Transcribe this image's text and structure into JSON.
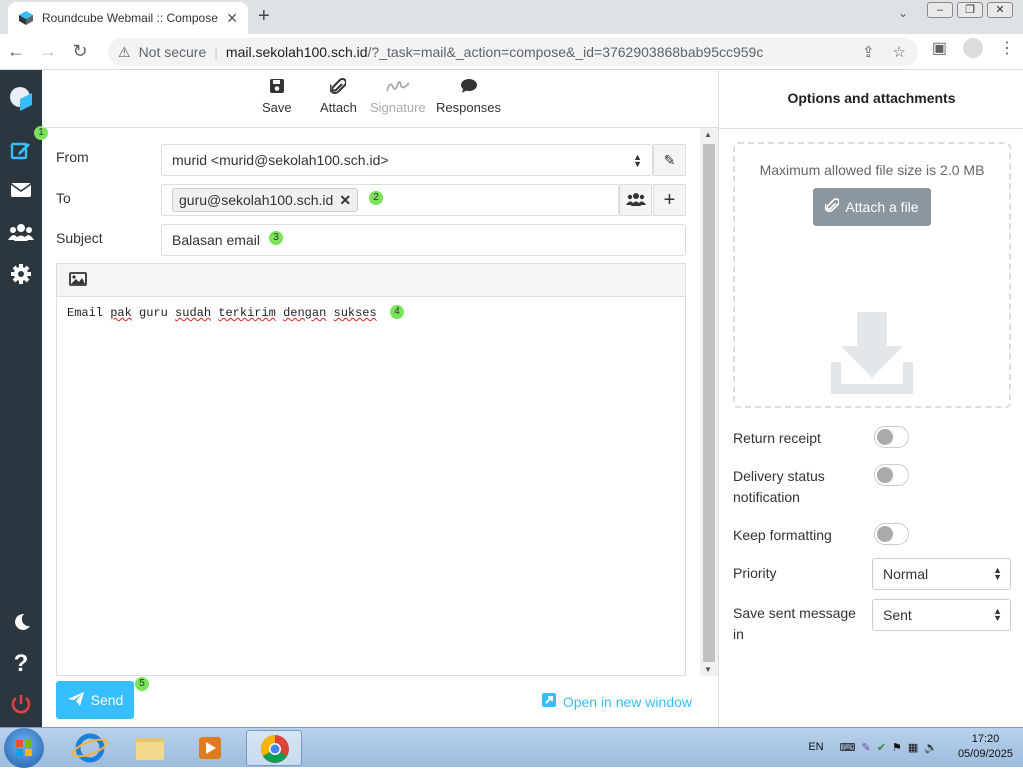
{
  "browser": {
    "tab_title": "Roundcube Webmail :: Compose",
    "not_secure": "Not secure",
    "host": "mail.sekolah100.sch.id",
    "path": "/?_task=mail&_action=compose&_id=3762903868bab95cc959c"
  },
  "toolbar": {
    "save": "Save",
    "attach": "Attach",
    "signature": "Signature",
    "responses": "Responses"
  },
  "compose": {
    "from_label": "From",
    "from_value": "murid <murid@sekolah100.sch.id>",
    "to_label": "To",
    "to_recipient": "guru@sekolah100.sch.id",
    "subject_label": "Subject",
    "subject_value": "Balasan email",
    "body": [
      "Email",
      "pak",
      "guru",
      "sudah",
      "terkirim",
      "dengan",
      "sukses"
    ],
    "send_label": "Send",
    "open_new_window": "Open in new window"
  },
  "badges": [
    "1",
    "2",
    "3",
    "4",
    "5"
  ],
  "options": {
    "title": "Options and attachments",
    "max_size": "Maximum allowed file size is 2.0 MB",
    "attach_file": "Attach a file",
    "return_receipt": "Return receipt",
    "delivery_status": "Delivery status notification",
    "keep_formatting": "Keep formatting",
    "priority_label": "Priority",
    "priority_value": "Normal",
    "save_sent_label": "Save sent message in",
    "save_sent_value": "Sent"
  },
  "taskbar": {
    "lang": "EN",
    "time": "17:20",
    "date": "05/09/2025"
  },
  "colors": {
    "accent": "#37beff",
    "sidebar": "#2c363f",
    "badge": "#7be35a"
  }
}
